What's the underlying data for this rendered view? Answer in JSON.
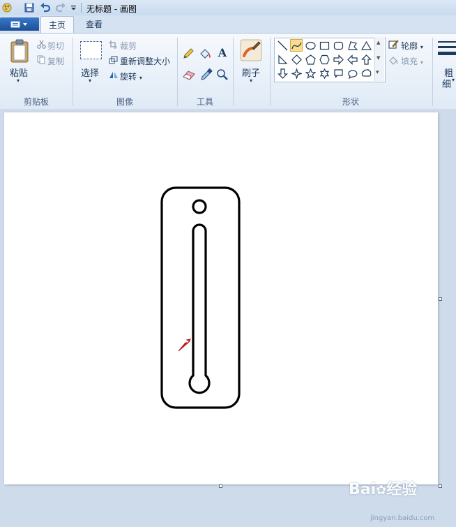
{
  "window": {
    "title": "无标题 - 画图"
  },
  "tabs": {
    "home": "主页",
    "view": "查看"
  },
  "clipboard": {
    "paste": "粘贴",
    "cut": "剪切",
    "copy": "复制",
    "label": "剪贴板"
  },
  "image": {
    "select": "选择",
    "crop": "裁剪",
    "resize": "重新调整大小",
    "rotate": "旋转",
    "label": "图像"
  },
  "tools": {
    "label": "工具"
  },
  "brushes": {
    "label": "刷子"
  },
  "shapes": {
    "outline": "轮廓",
    "fill": "填充",
    "label": "形状",
    "selected": "curve"
  },
  "size": {
    "label_line1": "粗",
    "label_line2": "细"
  },
  "colors": {
    "accent": "#2b63b5",
    "ribbon": "#f1f6fb",
    "workspace": "#cedbeb",
    "pointer": "#e02020"
  },
  "watermark": {
    "brand": "Bai",
    "brand2": "经验",
    "url": "jingyan.baidu.com"
  }
}
